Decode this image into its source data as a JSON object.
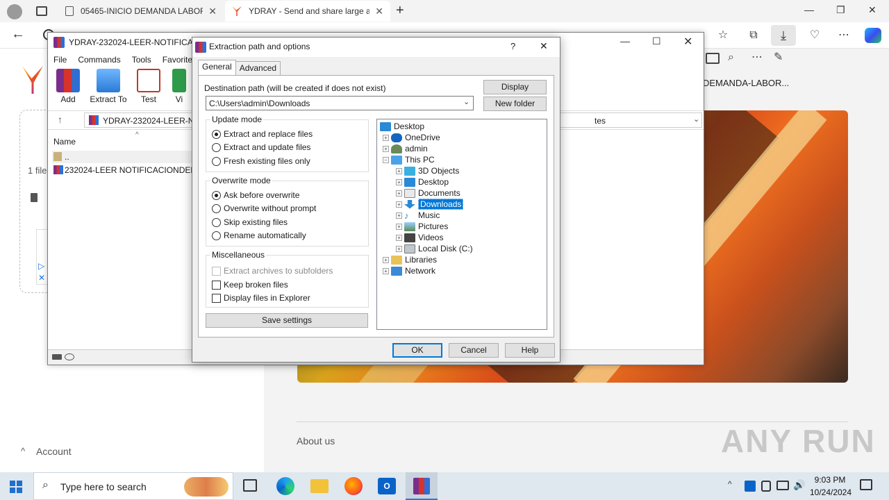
{
  "browser": {
    "tabs": [
      {
        "title": "05465-INICIO DEMANDA LABOR..."
      },
      {
        "title": "YDRAY - Send and share large an..."
      }
    ],
    "window_controls": {
      "minimize": "—",
      "maximize": "❐",
      "close": "✕"
    }
  },
  "page": {
    "left_text": {
      "files": "1 file",
      "account": "Account"
    },
    "right_title": "DEMANDA-LABOR...",
    "about": "About us",
    "watermark": "ANY RUN"
  },
  "winrar": {
    "title": "YDRAY-232024-LEER-NOTIFICACI",
    "menu": [
      "File",
      "Commands",
      "Tools",
      "Favorites"
    ],
    "toolbar": [
      "Add",
      "Extract To",
      "Test",
      "Vi"
    ],
    "path": "YDRAY-232024-LEER-NO",
    "path_right": "tes",
    "col_name": "Name",
    "rows": [
      "..",
      "232024-LEER NOTIFICACIONDEMA"
    ]
  },
  "dialog": {
    "title": "Extraction path and options",
    "help": "?",
    "close": "✕",
    "tabs": [
      "General",
      "Advanced"
    ],
    "dest_label": "Destination path (will be created if does not exist)",
    "dest_value": "C:\\Users\\admin\\Downloads",
    "display_btn": "Display",
    "new_folder_btn": "New folder",
    "update_mode": {
      "label": "Update mode",
      "options": [
        "Extract and replace files",
        "Extract and update files",
        "Fresh existing files only"
      ],
      "selected": 0
    },
    "overwrite_mode": {
      "label": "Overwrite mode",
      "options": [
        "Ask before overwrite",
        "Overwrite without prompt",
        "Skip existing files",
        "Rename automatically"
      ],
      "selected": 0
    },
    "misc": {
      "label": "Miscellaneous",
      "options": [
        "Extract archives to subfolders",
        "Keep broken files",
        "Display files in Explorer"
      ]
    },
    "save_settings": "Save settings",
    "tree": [
      "Desktop",
      "OneDrive",
      "admin",
      "This PC",
      "3D Objects",
      "Desktop",
      "Documents",
      "Downloads",
      "Music",
      "Pictures",
      "Videos",
      "Local Disk (C:)",
      "Libraries",
      "Network"
    ],
    "ok": "OK",
    "cancel": "Cancel",
    "help_btn": "Help"
  },
  "taskbar": {
    "search_placeholder": "Type here to search",
    "time": "9:03 PM",
    "date": "10/24/2024"
  }
}
